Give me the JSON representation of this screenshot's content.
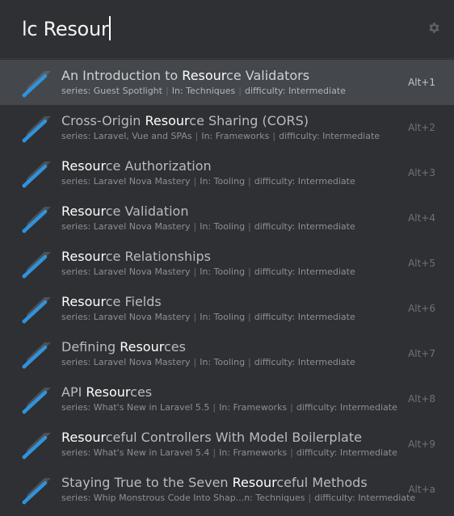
{
  "search": {
    "query": "lc Resour"
  },
  "icons": {
    "settings": "gear-icon",
    "result": "pen-nib-icon"
  },
  "colors": {
    "background": "#2e3033",
    "selected_row": "#44474c",
    "icon_accent": "#2f93dc",
    "highlight_text": "#ffffff"
  },
  "results": [
    {
      "title_parts": [
        {
          "text": "An Introduction to "
        },
        {
          "text": "Resour",
          "hl": true
        },
        {
          "text": "ce Validators"
        }
      ],
      "series": "series: Guest Spotlight",
      "category": "In: Techniques",
      "difficulty": "difficulty: Intermediate",
      "shortcut": "Alt+1",
      "selected": true
    },
    {
      "title_parts": [
        {
          "text": "Cross-Origin "
        },
        {
          "text": "Resour",
          "hl": true
        },
        {
          "text": "ce Sharing (CORS)"
        }
      ],
      "series": "series: Laravel, Vue and SPAs",
      "category": "In: Frameworks",
      "difficulty": "difficulty: Intermediate",
      "shortcut": "Alt+2"
    },
    {
      "title_parts": [
        {
          "text": "Resour",
          "hl": true
        },
        {
          "text": "ce Authorization"
        }
      ],
      "series": "series: Laravel Nova Mastery",
      "category": "In: Tooling",
      "difficulty": "difficulty: Intermediate",
      "shortcut": "Alt+3"
    },
    {
      "title_parts": [
        {
          "text": "Resour",
          "hl": true
        },
        {
          "text": "ce Validation"
        }
      ],
      "series": "series: Laravel Nova Mastery",
      "category": "In: Tooling",
      "difficulty": "difficulty: Intermediate",
      "shortcut": "Alt+4"
    },
    {
      "title_parts": [
        {
          "text": "Resour",
          "hl": true
        },
        {
          "text": "ce Relationships"
        }
      ],
      "series": "series: Laravel Nova Mastery",
      "category": "In: Tooling",
      "difficulty": "difficulty: Intermediate",
      "shortcut": "Alt+5"
    },
    {
      "title_parts": [
        {
          "text": "Resour",
          "hl": true
        },
        {
          "text": "ce Fields"
        }
      ],
      "series": "series: Laravel Nova Mastery",
      "category": "In: Tooling",
      "difficulty": "difficulty: Intermediate",
      "shortcut": "Alt+6"
    },
    {
      "title_parts": [
        {
          "text": "Defining "
        },
        {
          "text": "Resour",
          "hl": true
        },
        {
          "text": "ces"
        }
      ],
      "series": "series: Laravel Nova Mastery",
      "category": "In: Tooling",
      "difficulty": "difficulty: Intermediate",
      "shortcut": "Alt+7"
    },
    {
      "title_parts": [
        {
          "text": "API "
        },
        {
          "text": "Resour",
          "hl": true
        },
        {
          "text": "ces"
        }
      ],
      "series": "series: What's New in Laravel 5.5",
      "category": "In: Frameworks",
      "difficulty": "difficulty: Intermediate",
      "shortcut": "Alt+8"
    },
    {
      "title_parts": [
        {
          "text": "Resour",
          "hl": true
        },
        {
          "text": "ceful Controllers With Model Boilerplate"
        }
      ],
      "series": "series: What's New in Laravel 5.4",
      "category": "In: Frameworks",
      "difficulty": "difficulty: Intermediate",
      "shortcut": "Alt+9"
    },
    {
      "title_parts": [
        {
          "text": "Staying True to the Seven "
        },
        {
          "text": "Resour",
          "hl": true
        },
        {
          "text": "ceful Methods"
        }
      ],
      "series": "series: Whip Monstrous Code Into Shap...n",
      "category": "Techniques",
      "difficulty": "difficulty: Intermediate",
      "category_prefix_joined": true,
      "shortcut": "Alt+a"
    }
  ]
}
